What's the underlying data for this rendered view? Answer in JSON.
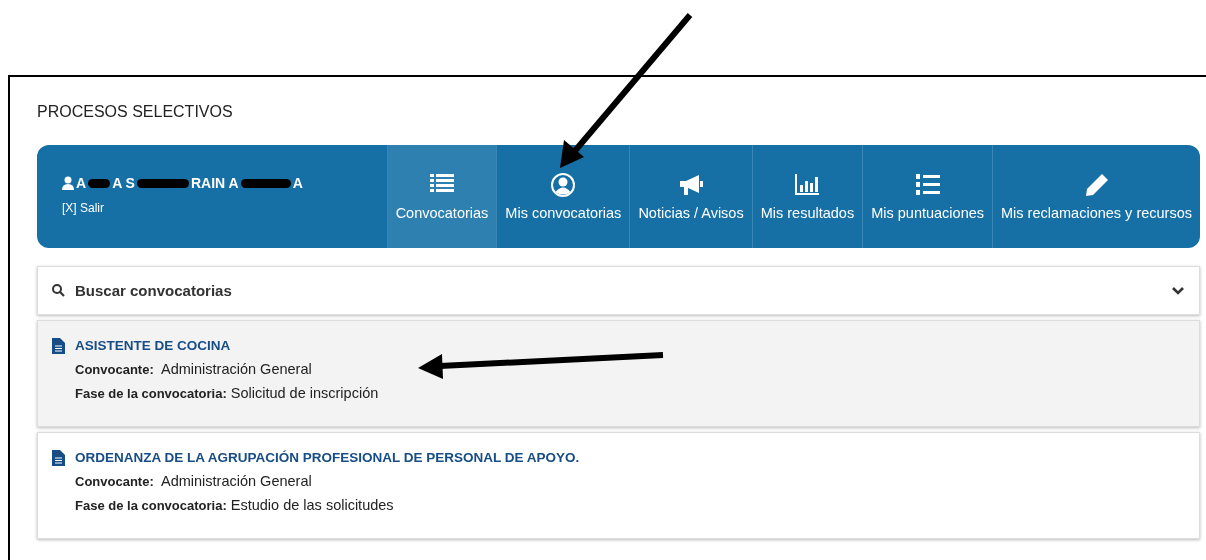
{
  "page_title": "PROCESOS SELECTIVOS",
  "user": {
    "name_fragments": [
      "A",
      "A S",
      "RAIN A",
      "A"
    ],
    "logout": "[X] Salir"
  },
  "tabs": [
    {
      "label": "Convocatorias",
      "selected": true
    },
    {
      "label": "Mis convocatorias",
      "selected": false
    },
    {
      "label": "Noticias / Avisos",
      "selected": false
    },
    {
      "label": "Mis resultados",
      "selected": false
    },
    {
      "label": "Mis puntuaciones",
      "selected": false
    },
    {
      "label": "Mis reclamaciones y recursos",
      "selected": false
    }
  ],
  "search": {
    "label": "Buscar convocatorias",
    "expanded": false
  },
  "calls": [
    {
      "title": "ASISTENTE DE COCINA",
      "convener_label": "Convocante:",
      "convener": "Administración General",
      "phase_label": "Fase de la convocatoria:",
      "phase": "Solicitud de inscripción",
      "selected": true
    },
    {
      "title": "ORDENANZA DE LA AGRUPACIÓN PROFESIONAL DE PERSONAL DE APOYO.",
      "convener_label": "Convocante:",
      "convener": "Administración General",
      "phase_label": "Fase de la convocatoria:",
      "phase": "Estudio de las solicitudes",
      "selected": false
    }
  ]
}
